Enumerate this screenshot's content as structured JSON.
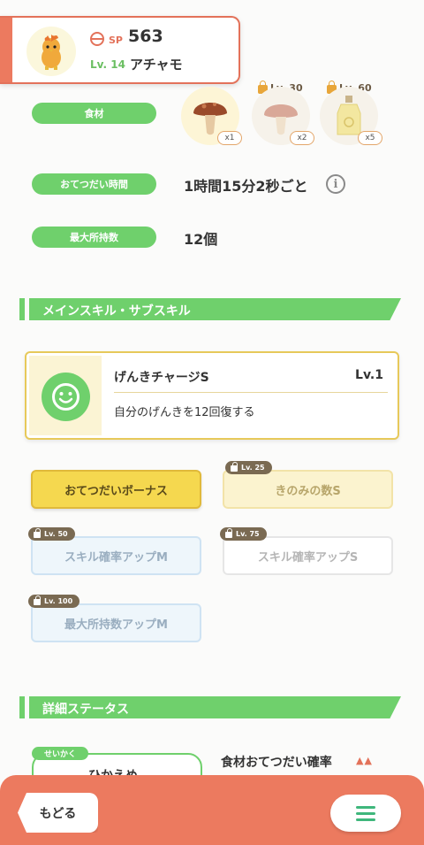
{
  "header": {
    "sp_label": "SP",
    "sp_value": "563",
    "level": "Lv. 14",
    "pokemon_name": "アチャモ"
  },
  "stats": {
    "ingredients_label": "食材",
    "help_time_label": "おてつだい時間",
    "help_time_value": "1時間15分2秒ごと",
    "max_carry_label": "最大所持数",
    "max_carry_value": "12個"
  },
  "ingredients": [
    {
      "count": "x1",
      "icon": "mushroom-icon"
    },
    {
      "lock": "Lv. 30",
      "count": "x2",
      "icon": "mushroom-icon"
    },
    {
      "lock": "Lv. 60",
      "count": "x5",
      "icon": "oil-bottle-icon"
    }
  ],
  "skills_section": {
    "title": "メインスキル・サブスキル"
  },
  "main_skill": {
    "name": "げんきチャージS",
    "level": "Lv.1",
    "description": "自分のげんきを12回復する"
  },
  "sub_skills": [
    {
      "label": "おてつだいボーナス"
    },
    {
      "label": "きのみの数S",
      "lock": "Lv. 25"
    },
    {
      "label": "スキル確率アップM",
      "lock": "Lv. 50"
    },
    {
      "label": "スキル確率アップS",
      "lock": "Lv. 75"
    },
    {
      "label": "最大所持数アップM",
      "lock": "Lv. 100"
    }
  ],
  "detail_section": {
    "title": "詳細ステータス",
    "nature_tag": "せいかく",
    "nature_value": "ひかえめ",
    "stat_label": "食材おてつだい確率",
    "stat_arrows": "▲▲"
  },
  "footer": {
    "back_label": "もどる"
  },
  "colors": {
    "accent_green": "#6fd06c",
    "accent_orange": "#ec7a5f",
    "skill_yellow": "#f5d84f"
  }
}
